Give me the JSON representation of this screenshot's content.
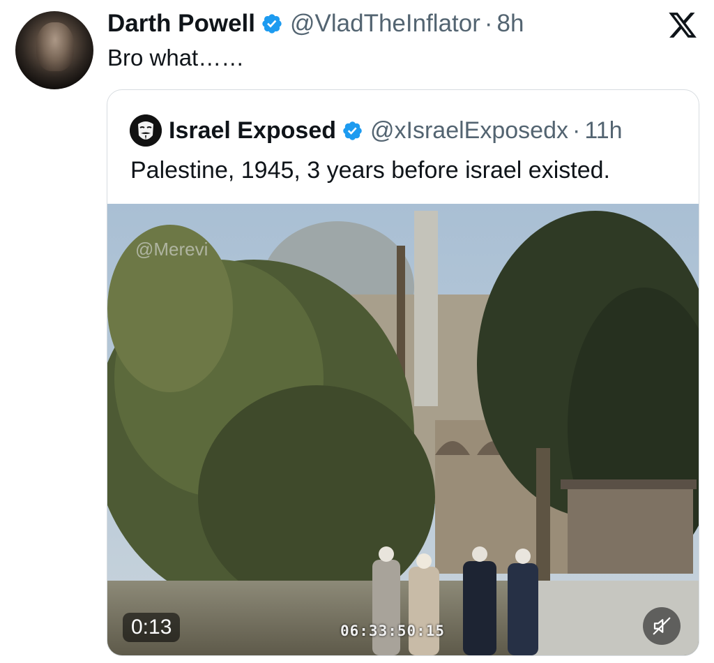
{
  "post": {
    "author_name": "Darth Powell",
    "author_handle": "@VladTheInflator",
    "separator": "·",
    "time": "8h",
    "text": "Bro what……"
  },
  "platform_icon": "x-logo-icon",
  "quoted_post": {
    "author_name": "Israel Exposed",
    "author_handle": "@xIsraelExposedx",
    "separator": "·",
    "time": "11h",
    "text": "Palestine, 1945, 3 years before israel existed.",
    "video": {
      "duration": "0:13",
      "timecode_overlay": "06:33:50:15",
      "watermark": "@Merevi",
      "mute_icon": "muted-speaker-icon"
    }
  },
  "colors": {
    "verified_blue": "#1d9bf0",
    "secondary_text": "#536471",
    "primary_text": "#0f1419",
    "border": "#d7dce0"
  }
}
